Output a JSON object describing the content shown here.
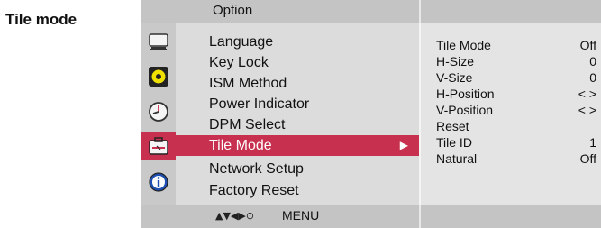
{
  "page": {
    "title": "Tile mode"
  },
  "osd": {
    "title": "Option",
    "side_icons": [
      {
        "name": "picture-icon"
      },
      {
        "name": "audio-icon"
      },
      {
        "name": "timer-icon"
      },
      {
        "name": "option-icon",
        "active": true
      },
      {
        "name": "info-icon"
      }
    ],
    "menu_items": [
      {
        "label": "Language"
      },
      {
        "label": "Key Lock"
      },
      {
        "label": "ISM Method"
      },
      {
        "label": "Power Indicator"
      },
      {
        "label": "DPM Select"
      },
      {
        "label": "Tile Mode",
        "selected": true
      },
      {
        "label": "Network Setup"
      },
      {
        "label": "Factory Reset"
      }
    ],
    "submenu": [
      {
        "label": "Tile Mode",
        "value": "Off"
      },
      {
        "label": "H-Size",
        "value": "0"
      },
      {
        "label": "V-Size",
        "value": "0"
      },
      {
        "label": "H-Position",
        "value": "< >"
      },
      {
        "label": "V-Position",
        "value": "< >"
      },
      {
        "label": "Reset",
        "value": ""
      },
      {
        "label": "Tile ID",
        "value": "1"
      },
      {
        "label": "Natural",
        "value": "Off"
      }
    ],
    "footer": {
      "nav_hint": "▲▼◀▶⊙",
      "menu_label": "MENU"
    },
    "colors": {
      "highlight": "#c8304f",
      "panel": "#d8d8d8"
    }
  }
}
